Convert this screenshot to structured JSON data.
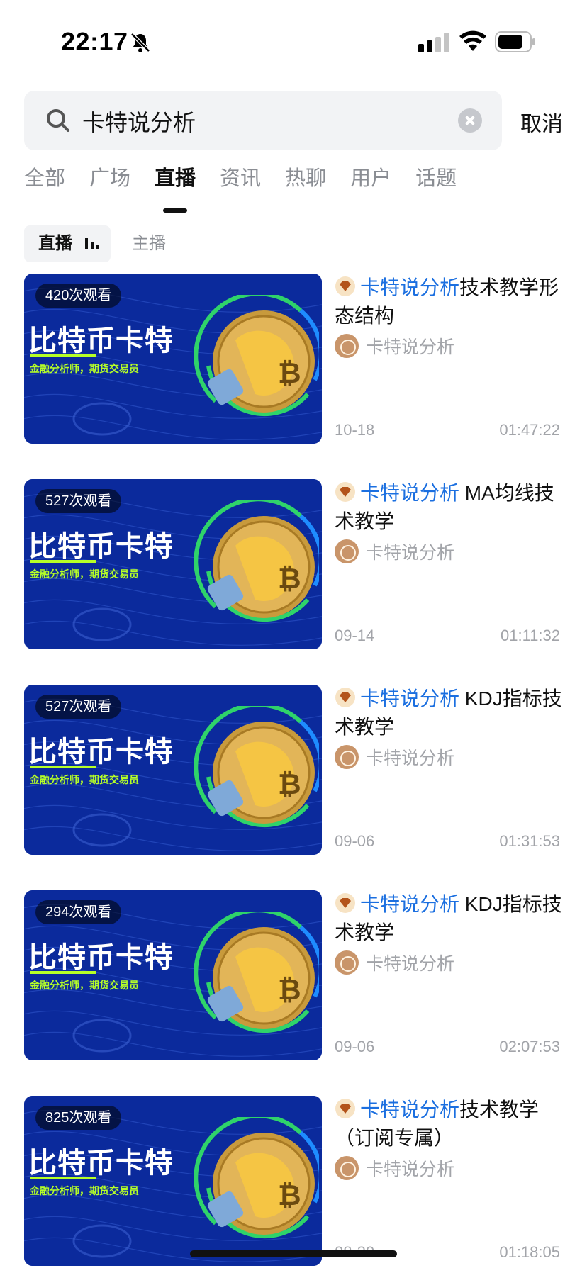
{
  "status_bar": {
    "time": "22:17"
  },
  "search": {
    "query": "卡特说分析",
    "cancel_label": "取消"
  },
  "tabs": [
    {
      "label": "全部",
      "active": false
    },
    {
      "label": "广场",
      "active": false
    },
    {
      "label": "直播",
      "active": true
    },
    {
      "label": "资讯",
      "active": false
    },
    {
      "label": "热聊",
      "active": false
    },
    {
      "label": "用户",
      "active": false
    },
    {
      "label": "话题",
      "active": false
    }
  ],
  "subtabs": {
    "live": "直播",
    "host": "主播"
  },
  "thumbnail": {
    "title": "比特币卡特",
    "subtitle": "金融分析师，期货交易员"
  },
  "items": [
    {
      "views": "420次观看",
      "title_highlight": "卡特说分析",
      "title_rest": "技术教学形态结构",
      "author": "卡特说分析",
      "date": "10-18",
      "duration": "01:47:22"
    },
    {
      "views": "527次观看",
      "title_highlight": "卡特说分析",
      "title_rest": " MA均线技术教学",
      "author": "卡特说分析",
      "date": "09-14",
      "duration": "01:11:32"
    },
    {
      "views": "527次观看",
      "title_highlight": "卡特说分析",
      "title_rest": " KDJ指标技术教学",
      "author": "卡特说分析",
      "date": "09-06",
      "duration": "01:31:53"
    },
    {
      "views": "294次观看",
      "title_highlight": "卡特说分析",
      "title_rest": " KDJ指标技术教学",
      "author": "卡特说分析",
      "date": "09-06",
      "duration": "02:07:53"
    },
    {
      "views": "825次观看",
      "title_highlight": "卡特说分析",
      "title_rest": "技术教学（订阅专属）",
      "author": "卡特说分析",
      "date": "08-30",
      "duration": "01:18:05"
    }
  ],
  "colors": {
    "accent": "#1b6fe0",
    "thumb_bg": "#0b2a9c",
    "thumb_green": "#b6ff27"
  }
}
